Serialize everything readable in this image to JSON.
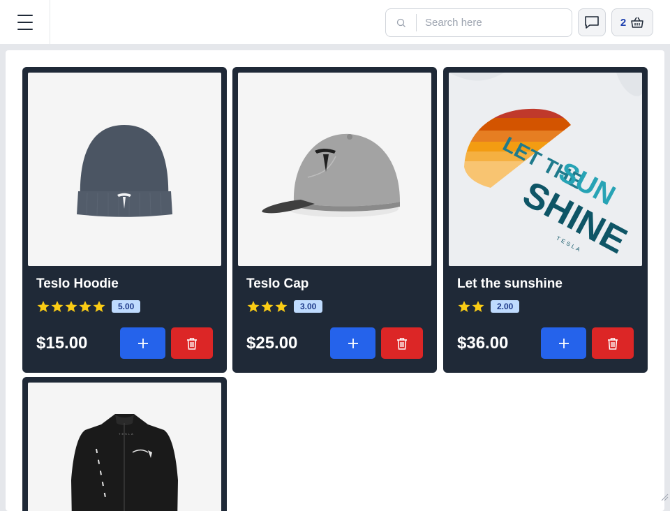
{
  "header": {
    "search": {
      "placeholder": "Search here"
    },
    "cart": {
      "count": "2"
    }
  },
  "products": [
    {
      "title": "Teslo Hoodie",
      "rating": 5,
      "rating_label": "5.00",
      "price": "$15.00",
      "image": "beanie"
    },
    {
      "title": "Teslo Cap",
      "rating": 3,
      "rating_label": "3.00",
      "price": "$25.00",
      "image": "cap"
    },
    {
      "title": "Let the sunshine",
      "rating": 2,
      "rating_label": "2.00",
      "price": "$36.00",
      "image": "sunshine-shirt"
    },
    {
      "title": "",
      "rating": 0,
      "rating_label": "",
      "price": "",
      "image": "jacket"
    }
  ],
  "colors": {
    "card": "#1f2937",
    "add": "#2563eb",
    "delete": "#dc2626",
    "star": "#facc15",
    "badge": "#bfdbfe"
  }
}
